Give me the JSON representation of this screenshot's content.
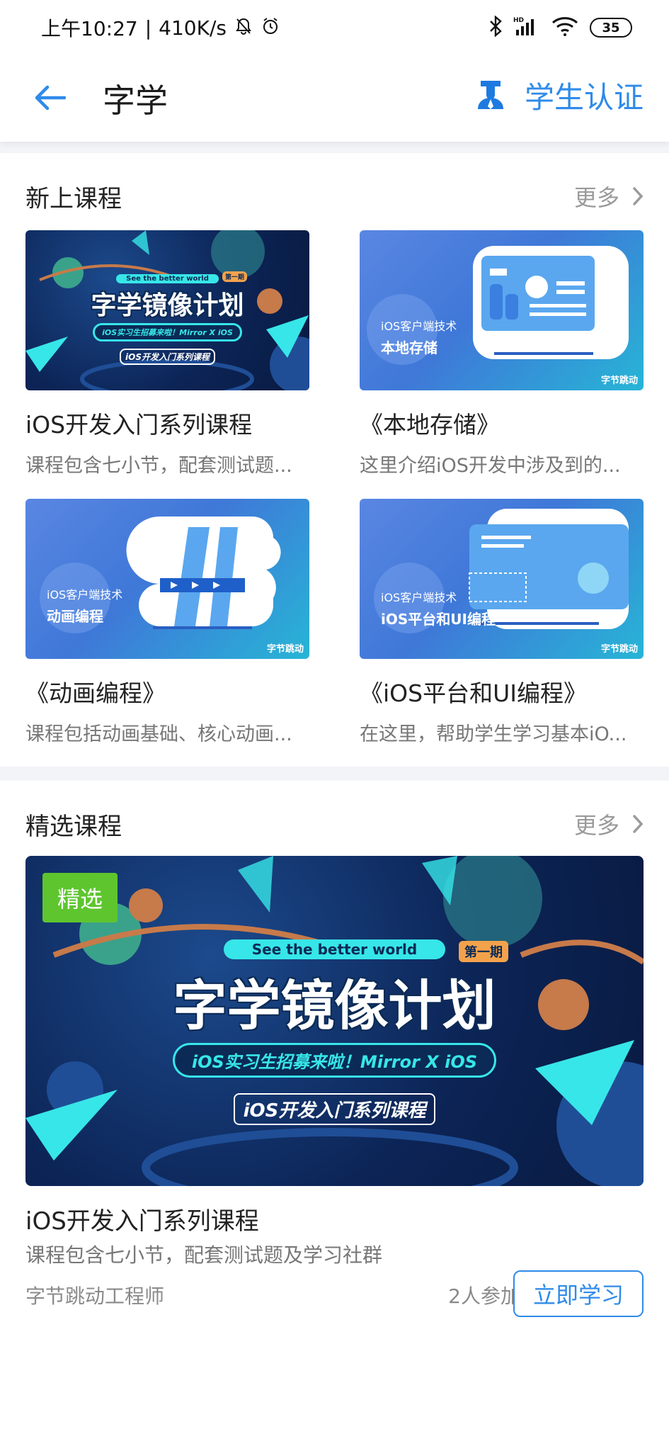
{
  "status_bar": {
    "time": "上午10:27",
    "speed": "410K/s",
    "battery": "35",
    "network": "HD"
  },
  "nav": {
    "title": "字学",
    "student_auth": "学生认证"
  },
  "new_courses": {
    "title": "新上课程",
    "more": "更多",
    "cards": [
      {
        "title": "iOS开发入门系列课程",
        "desc": "课程包含七小节，配套测试题...",
        "art": {
          "pill": "See the better world",
          "issue": "第一期",
          "main": "字学镜像计划",
          "sub": "iOS实习生招募来啦！Mirror X iOS",
          "tag": "iOS开发入门系列课程"
        }
      },
      {
        "title": "《本地存储》",
        "desc": "这里介绍iOS开发中涉及到的...",
        "art": {
          "small": "iOS客户端技术",
          "big": "本地存储",
          "brand": "字节跳动"
        }
      },
      {
        "title": "《动画编程》",
        "desc": "课程包括动画基础、核心动画...",
        "art": {
          "small": "iOS客户端技术",
          "big": "动画编程",
          "brand": "字节跳动"
        }
      },
      {
        "title": "《iOS平台和UI编程》",
        "desc": "在这里，帮助学生学习基本iO...",
        "art": {
          "small": "iOS客户端技术",
          "big": "iOS平台和UI编程",
          "brand": "字节跳动"
        }
      }
    ]
  },
  "featured": {
    "title": "精选课程",
    "more": "更多",
    "badge": "精选",
    "art": {
      "pill": "See the better world",
      "issue": "第一期",
      "main": "字学镜像计划",
      "sub": "iOS实习生招募来啦！Mirror X iOS",
      "tag": "iOS开发入门系列课程"
    },
    "course_title": "iOS开发入门系列课程",
    "course_desc": "课程包含七小节，配套测试题及学习社群",
    "author": "字节跳动工程师",
    "participants": "2人参加",
    "cta": "立即学习"
  },
  "colors": {
    "accent": "#2f8be9",
    "featured_badge": "#5ec52e"
  }
}
